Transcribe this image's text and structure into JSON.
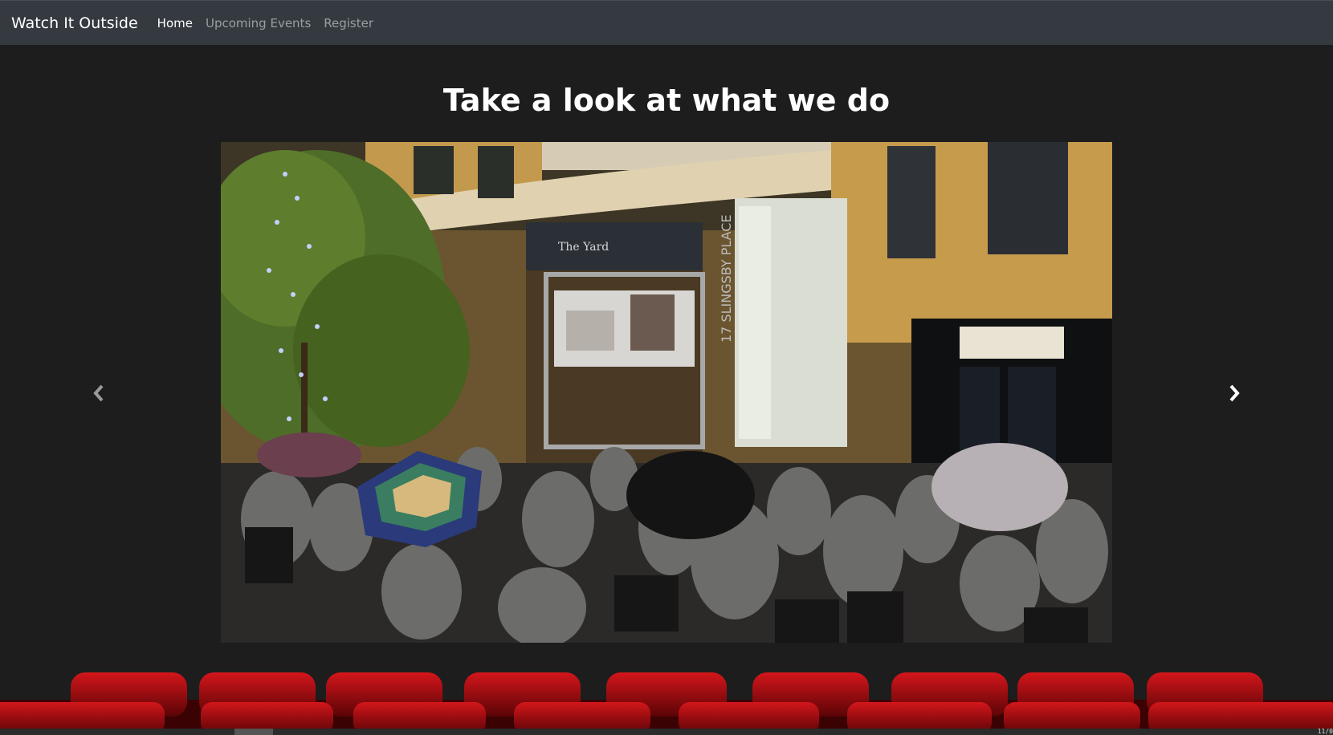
{
  "nav": {
    "brand": "Watch It Outside",
    "links": [
      {
        "label": "Home",
        "active": true
      },
      {
        "label": "Upcoming Events",
        "active": false
      },
      {
        "label": "Register",
        "active": false
      }
    ]
  },
  "main": {
    "heading": "Take a look at what we do"
  },
  "carousel": {
    "prev_icon": "chevron-left-icon",
    "next_icon": "chevron-right-icon",
    "slide_texts": {
      "building_sign": "17 SLINGSBY PLACE",
      "venue_sign": "The Yard"
    }
  },
  "colors": {
    "navbar_bg": "#343a40",
    "page_bg": "#1d1d1e",
    "seat_red": "#b00f14"
  },
  "status": {
    "corner_text": "11/0"
  }
}
